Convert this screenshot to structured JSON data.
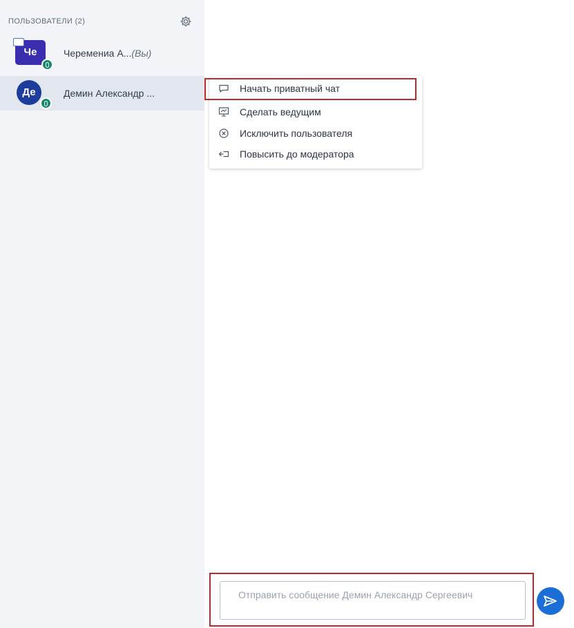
{
  "sidebar": {
    "title": "ПОЛЬЗОВАТЕЛИ (2)",
    "settings_icon": "gear-icon",
    "users": [
      {
        "initials": "Че",
        "name": "Черемениа А...",
        "name_full": "Черемениа А...",
        "you_label": "(Вы)",
        "is_presenter": true,
        "status_icon": "microphone-icon"
      },
      {
        "initials": "Де",
        "name": "Демин Александр ...",
        "is_presenter": false,
        "status_icon": "microphone-icon"
      }
    ]
  },
  "context_menu": {
    "items": [
      {
        "label": "Начать приватный чат",
        "icon": "chat-bubble-icon"
      },
      {
        "label": "Сделать ведущим",
        "icon": "presentation-screen-icon"
      },
      {
        "label": "Исключить пользователя",
        "icon": "remove-circle-icon"
      },
      {
        "label": "Повысить до модератора",
        "icon": "promote-icon"
      }
    ]
  },
  "chat": {
    "input_placeholder": "Отправить сообщение Демин Александр Сергеевич",
    "send_icon": "send-icon"
  },
  "colors": {
    "sidebar_bg": "#f2f4f7",
    "selected_row_bg": "#e2e6ee",
    "highlight_border": "#c0272d",
    "send_button": "#1b6ed6",
    "status_online": "#138a6b",
    "avatar_you": "#3b2db0",
    "avatar_other": "#1c3d9c"
  }
}
